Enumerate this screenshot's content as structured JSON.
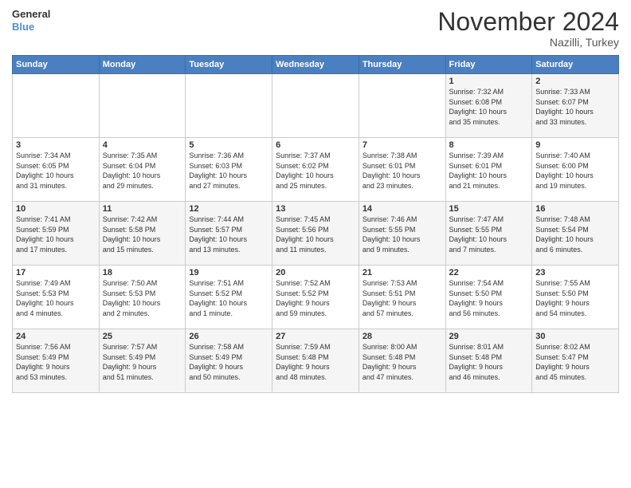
{
  "header": {
    "logo_line1": "General",
    "logo_line2": "Blue",
    "month": "November 2024",
    "location": "Nazilli, Turkey"
  },
  "weekdays": [
    "Sunday",
    "Monday",
    "Tuesday",
    "Wednesday",
    "Thursday",
    "Friday",
    "Saturday"
  ],
  "weeks": [
    [
      {
        "day": "",
        "info": ""
      },
      {
        "day": "",
        "info": ""
      },
      {
        "day": "",
        "info": ""
      },
      {
        "day": "",
        "info": ""
      },
      {
        "day": "",
        "info": ""
      },
      {
        "day": "1",
        "info": "Sunrise: 7:32 AM\nSunset: 6:08 PM\nDaylight: 10 hours\nand 35 minutes."
      },
      {
        "day": "2",
        "info": "Sunrise: 7:33 AM\nSunset: 6:07 PM\nDaylight: 10 hours\nand 33 minutes."
      }
    ],
    [
      {
        "day": "3",
        "info": "Sunrise: 7:34 AM\nSunset: 6:05 PM\nDaylight: 10 hours\nand 31 minutes."
      },
      {
        "day": "4",
        "info": "Sunrise: 7:35 AM\nSunset: 6:04 PM\nDaylight: 10 hours\nand 29 minutes."
      },
      {
        "day": "5",
        "info": "Sunrise: 7:36 AM\nSunset: 6:03 PM\nDaylight: 10 hours\nand 27 minutes."
      },
      {
        "day": "6",
        "info": "Sunrise: 7:37 AM\nSunset: 6:02 PM\nDaylight: 10 hours\nand 25 minutes."
      },
      {
        "day": "7",
        "info": "Sunrise: 7:38 AM\nSunset: 6:01 PM\nDaylight: 10 hours\nand 23 minutes."
      },
      {
        "day": "8",
        "info": "Sunrise: 7:39 AM\nSunset: 6:01 PM\nDaylight: 10 hours\nand 21 minutes."
      },
      {
        "day": "9",
        "info": "Sunrise: 7:40 AM\nSunset: 6:00 PM\nDaylight: 10 hours\nand 19 minutes."
      }
    ],
    [
      {
        "day": "10",
        "info": "Sunrise: 7:41 AM\nSunset: 5:59 PM\nDaylight: 10 hours\nand 17 minutes."
      },
      {
        "day": "11",
        "info": "Sunrise: 7:42 AM\nSunset: 5:58 PM\nDaylight: 10 hours\nand 15 minutes."
      },
      {
        "day": "12",
        "info": "Sunrise: 7:44 AM\nSunset: 5:57 PM\nDaylight: 10 hours\nand 13 minutes."
      },
      {
        "day": "13",
        "info": "Sunrise: 7:45 AM\nSunset: 5:56 PM\nDaylight: 10 hours\nand 11 minutes."
      },
      {
        "day": "14",
        "info": "Sunrise: 7:46 AM\nSunset: 5:55 PM\nDaylight: 10 hours\nand 9 minutes."
      },
      {
        "day": "15",
        "info": "Sunrise: 7:47 AM\nSunset: 5:55 PM\nDaylight: 10 hours\nand 7 minutes."
      },
      {
        "day": "16",
        "info": "Sunrise: 7:48 AM\nSunset: 5:54 PM\nDaylight: 10 hours\nand 6 minutes."
      }
    ],
    [
      {
        "day": "17",
        "info": "Sunrise: 7:49 AM\nSunset: 5:53 PM\nDaylight: 10 hours\nand 4 minutes."
      },
      {
        "day": "18",
        "info": "Sunrise: 7:50 AM\nSunset: 5:53 PM\nDaylight: 10 hours\nand 2 minutes."
      },
      {
        "day": "19",
        "info": "Sunrise: 7:51 AM\nSunset: 5:52 PM\nDaylight: 10 hours\nand 1 minute."
      },
      {
        "day": "20",
        "info": "Sunrise: 7:52 AM\nSunset: 5:52 PM\nDaylight: 9 hours\nand 59 minutes."
      },
      {
        "day": "21",
        "info": "Sunrise: 7:53 AM\nSunset: 5:51 PM\nDaylight: 9 hours\nand 57 minutes."
      },
      {
        "day": "22",
        "info": "Sunrise: 7:54 AM\nSunset: 5:50 PM\nDaylight: 9 hours\nand 56 minutes."
      },
      {
        "day": "23",
        "info": "Sunrise: 7:55 AM\nSunset: 5:50 PM\nDaylight: 9 hours\nand 54 minutes."
      }
    ],
    [
      {
        "day": "24",
        "info": "Sunrise: 7:56 AM\nSunset: 5:49 PM\nDaylight: 9 hours\nand 53 minutes."
      },
      {
        "day": "25",
        "info": "Sunrise: 7:57 AM\nSunset: 5:49 PM\nDaylight: 9 hours\nand 51 minutes."
      },
      {
        "day": "26",
        "info": "Sunrise: 7:58 AM\nSunset: 5:49 PM\nDaylight: 9 hours\nand 50 minutes."
      },
      {
        "day": "27",
        "info": "Sunrise: 7:59 AM\nSunset: 5:48 PM\nDaylight: 9 hours\nand 48 minutes."
      },
      {
        "day": "28",
        "info": "Sunrise: 8:00 AM\nSunset: 5:48 PM\nDaylight: 9 hours\nand 47 minutes."
      },
      {
        "day": "29",
        "info": "Sunrise: 8:01 AM\nSunset: 5:48 PM\nDaylight: 9 hours\nand 46 minutes."
      },
      {
        "day": "30",
        "info": "Sunrise: 8:02 AM\nSunset: 5:47 PM\nDaylight: 9 hours\nand 45 minutes."
      }
    ]
  ]
}
